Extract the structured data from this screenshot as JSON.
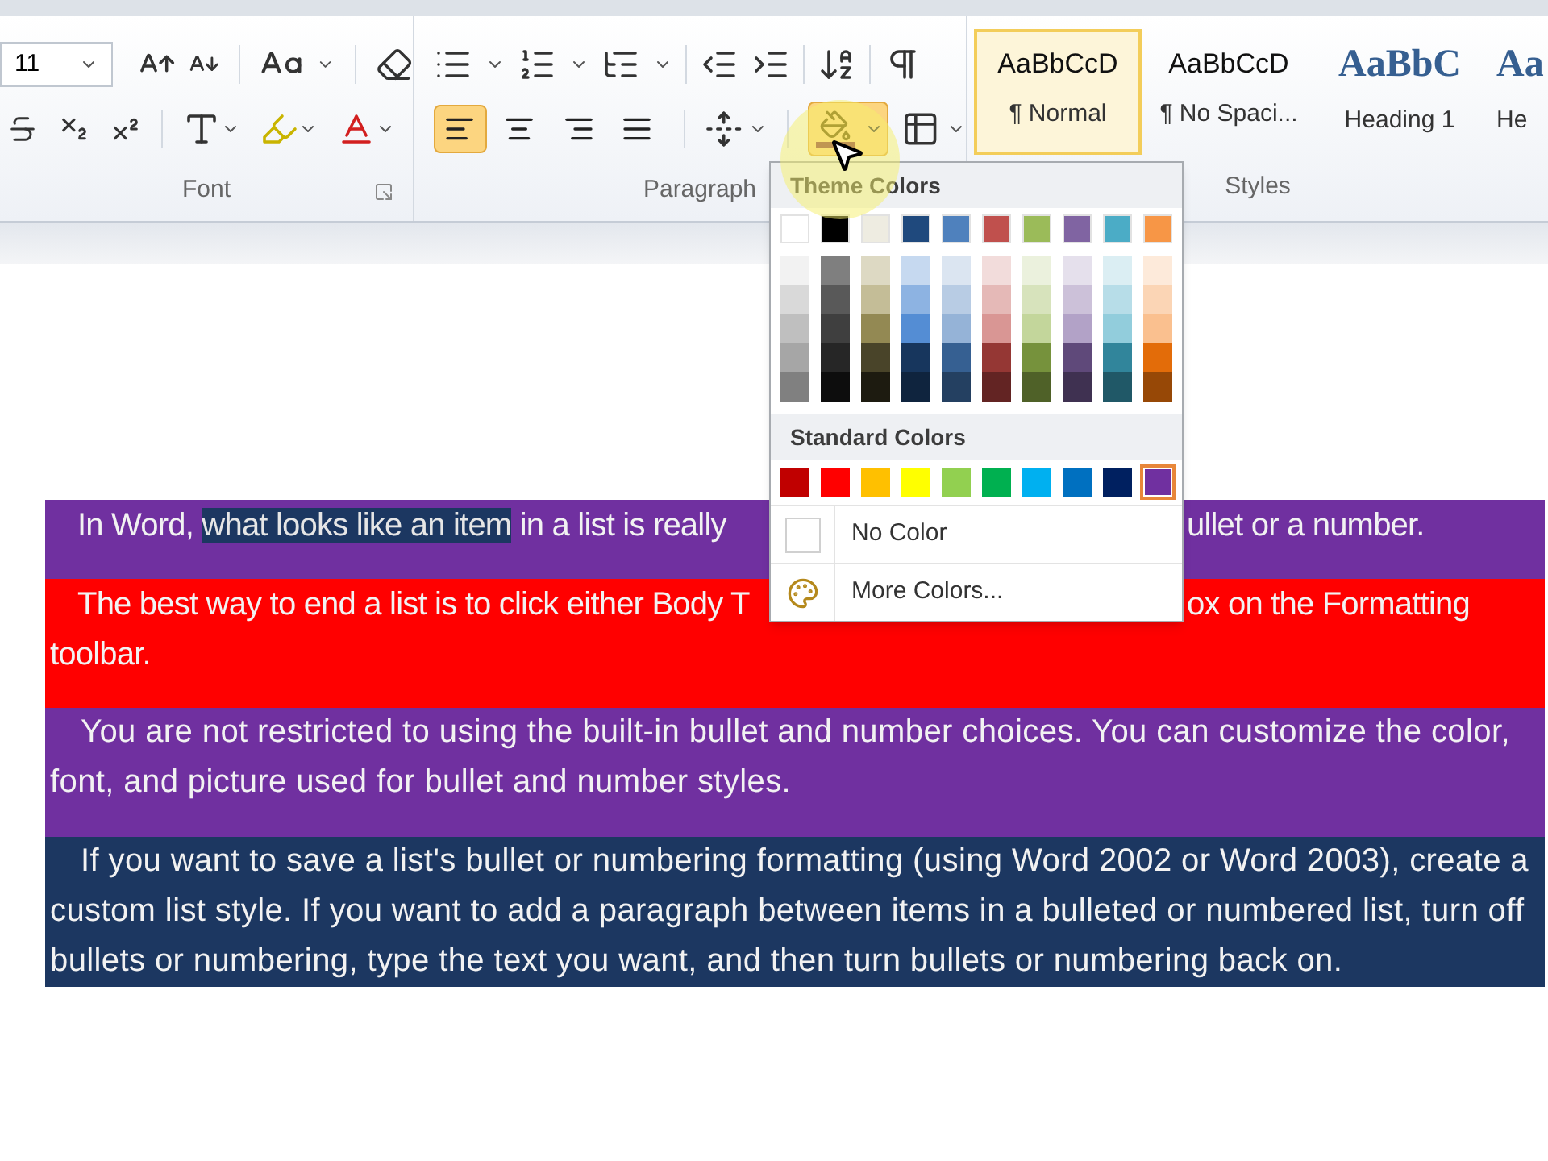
{
  "ribbon": {
    "font_group": {
      "label": "Font",
      "font_size": "11"
    },
    "paragraph_group": {
      "label": "Paragraph",
      "align_buttons": [
        {
          "kind": "left",
          "selected": true
        },
        {
          "kind": "center",
          "selected": false
        },
        {
          "kind": "right",
          "selected": false
        },
        {
          "kind": "justify",
          "selected": false
        }
      ],
      "shading_menu_open": true
    },
    "styles_group": {
      "label": "Styles",
      "styles": [
        {
          "kind": "body",
          "preview": "AaBbCcD",
          "name": "¶ Normal",
          "selected": true
        },
        {
          "kind": "body",
          "preview": "AaBbCcD",
          "name": "¶ No Spaci...",
          "selected": false
        },
        {
          "kind": "heading",
          "preview": "AaBbC",
          "name": "Heading 1",
          "selected": false
        },
        {
          "kind": "heading",
          "preview": "Aa",
          "name": "He",
          "selected": false
        }
      ]
    }
  },
  "color_menu": {
    "theme_title": "Theme Colors",
    "theme_colors": [
      {
        "color": "#ffffff",
        "shades": [
          {
            "color": "#f2f2f2"
          },
          {
            "color": "#d9d9d9"
          },
          {
            "color": "#bfbfbf"
          },
          {
            "color": "#a6a6a6"
          },
          {
            "color": "#808080"
          }
        ]
      },
      {
        "color": "#000000",
        "shades": [
          {
            "color": "#7f7f7f"
          },
          {
            "color": "#595959"
          },
          {
            "color": "#3f3f3f"
          },
          {
            "color": "#262626"
          },
          {
            "color": "#0d0d0d"
          }
        ]
      },
      {
        "color": "#eeece1",
        "shades": [
          {
            "color": "#ddd9c3"
          },
          {
            "color": "#c4bd97"
          },
          {
            "color": "#938953"
          },
          {
            "color": "#494429"
          },
          {
            "color": "#1d1b10"
          }
        ]
      },
      {
        "color": "#1f497d",
        "shades": [
          {
            "color": "#c6d9f0"
          },
          {
            "color": "#8db3e2"
          },
          {
            "color": "#548dd4"
          },
          {
            "color": "#17365d"
          },
          {
            "color": "#0f243e"
          }
        ]
      },
      {
        "color": "#4f81bd",
        "shades": [
          {
            "color": "#dbe5f1"
          },
          {
            "color": "#b8cce4"
          },
          {
            "color": "#95b3d7"
          },
          {
            "color": "#366092"
          },
          {
            "color": "#244061"
          }
        ]
      },
      {
        "color": "#c0504d",
        "shades": [
          {
            "color": "#f2dcdb"
          },
          {
            "color": "#e5b9b7"
          },
          {
            "color": "#d99694"
          },
          {
            "color": "#953734"
          },
          {
            "color": "#632423"
          }
        ]
      },
      {
        "color": "#9bbb59",
        "shades": [
          {
            "color": "#ebf1dd"
          },
          {
            "color": "#d7e3bc"
          },
          {
            "color": "#c3d69b"
          },
          {
            "color": "#76923c"
          },
          {
            "color": "#4f6128"
          }
        ]
      },
      {
        "color": "#8064a2",
        "shades": [
          {
            "color": "#e5e0ec"
          },
          {
            "color": "#ccc1d9"
          },
          {
            "color": "#b2a2c7"
          },
          {
            "color": "#5f497a"
          },
          {
            "color": "#3f3151"
          }
        ]
      },
      {
        "color": "#4bacc6",
        "shades": [
          {
            "color": "#dbeef3"
          },
          {
            "color": "#b7dde8"
          },
          {
            "color": "#92cddc"
          },
          {
            "color": "#31859b"
          },
          {
            "color": "#205867"
          }
        ]
      },
      {
        "color": "#f79646",
        "shades": [
          {
            "color": "#fdeada"
          },
          {
            "color": "#fbd5b5"
          },
          {
            "color": "#fac08f"
          },
          {
            "color": "#e36c09"
          },
          {
            "color": "#974806"
          }
        ]
      }
    ],
    "standard_title": "Standard Colors",
    "standard_colors": [
      {
        "color": "#c00000",
        "selected": false
      },
      {
        "color": "#ff0000",
        "selected": false
      },
      {
        "color": "#ffc000",
        "selected": false
      },
      {
        "color": "#ffff00",
        "selected": false
      },
      {
        "color": "#92d050",
        "selected": false
      },
      {
        "color": "#00b050",
        "selected": false
      },
      {
        "color": "#00b0f0",
        "selected": false
      },
      {
        "color": "#0070c0",
        "selected": false
      },
      {
        "color": "#002060",
        "selected": false
      },
      {
        "color": "#7030a0",
        "selected": true
      }
    ],
    "no_color": "No Color",
    "more_colors": "More Colors..."
  },
  "document": {
    "paragraphs": [
      {
        "kind": "split",
        "color": "#7030a0",
        "lines": [
          {
            "segments": [
              {
                "text": "In Word, ",
                "selected": false
              },
              {
                "text": "what looks like an item",
                "selected": true
              },
              {
                "text": " in a list is really",
                "selected": false
              }
            ],
            "right": "ullet or a number."
          }
        ]
      },
      {
        "kind": "split",
        "color": "#ff0000",
        "lines": [
          {
            "segments": [
              {
                "text": "The best way to end a list is to click either Body T",
                "selected": false
              }
            ],
            "right": "ox on the Formatting"
          },
          {
            "segments": [
              {
                "text": "toolbar.",
                "selected": false
              }
            ]
          }
        ]
      },
      {
        "kind": "flow",
        "color": "#7030a0",
        "text": "You are not restricted to using the built-in bullet and number choices. You can customize the color, font, and picture used for bullet and number styles."
      },
      {
        "kind": "flow",
        "color": "#1c3761",
        "text": "If you want to save a list's bullet or numbering formatting (using Word 2002 or Word 2003), create a custom list style. If you want to add a paragraph between items in a bulleted or numbered list, turn off bullets or numbering, type the text you want, and then turn bullets or numbering back on."
      }
    ]
  }
}
